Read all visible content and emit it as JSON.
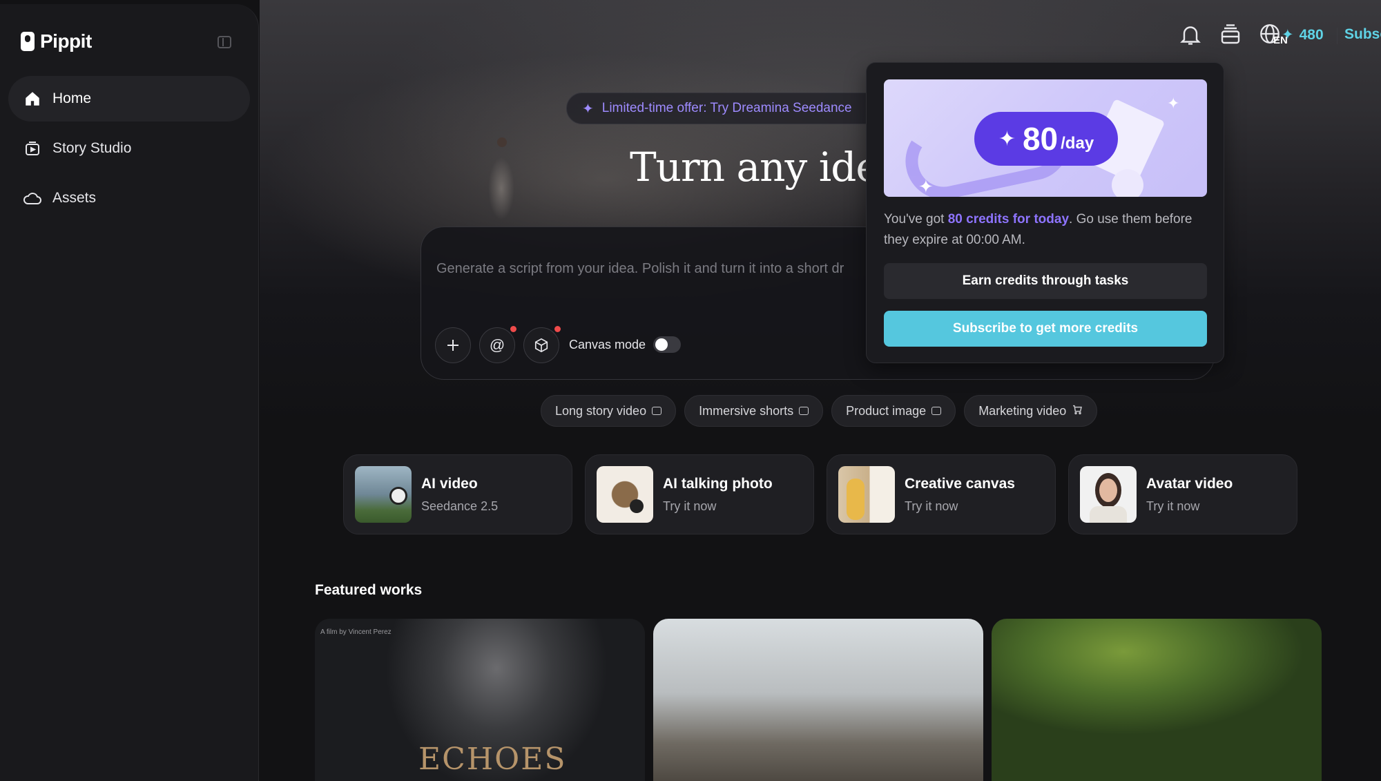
{
  "brand": {
    "name": "Pippit"
  },
  "sidebar": {
    "items": [
      {
        "label": "Home",
        "icon": "home-icon",
        "active": true
      },
      {
        "label": "Story Studio",
        "icon": "story-studio-icon",
        "active": false
      },
      {
        "label": "Assets",
        "icon": "cloud-icon",
        "active": false
      }
    ]
  },
  "topbar": {
    "credits": "480",
    "subscribe_label": "Subscribe",
    "language": "EN",
    "accent_color": "#5fd3e6"
  },
  "hero": {
    "offer_text": "Limited-time offer: Try Dreamina Seedance",
    "headline": "Turn any idea in"
  },
  "prompt": {
    "placeholder": "Generate a script from your idea. Polish it and turn it into a short dr",
    "canvas_mode_label": "Canvas mode",
    "canvas_mode_on": false
  },
  "chips": [
    {
      "label": "Long story video"
    },
    {
      "label": "Immersive shorts"
    },
    {
      "label": "Product image"
    },
    {
      "label": "Marketing video"
    }
  ],
  "cards": [
    {
      "title": "AI video",
      "subtitle": "Seedance 2.5"
    },
    {
      "title": "AI talking photo",
      "subtitle": "Try it now"
    },
    {
      "title": "Creative canvas",
      "subtitle": "Try it now"
    },
    {
      "title": "Avatar video",
      "subtitle": "Try it now"
    }
  ],
  "featured": {
    "title": "Featured works",
    "works": [
      {
        "title": "ECHOES",
        "credit": "A film by Vincent Perez"
      },
      {
        "title": ""
      },
      {
        "title": ""
      }
    ]
  },
  "popup": {
    "amount": "80",
    "unit": "/day",
    "text_prefix": "You've got ",
    "text_highlight": "80 credits for today",
    "text_suffix": ". Go use them before they expire at 00:00 AM.",
    "earn_label": "Earn credits through tasks",
    "subscribe_label": "Subscribe to get more credits",
    "primary_color": "#55c7de",
    "highlight_color": "#8e74ff"
  }
}
